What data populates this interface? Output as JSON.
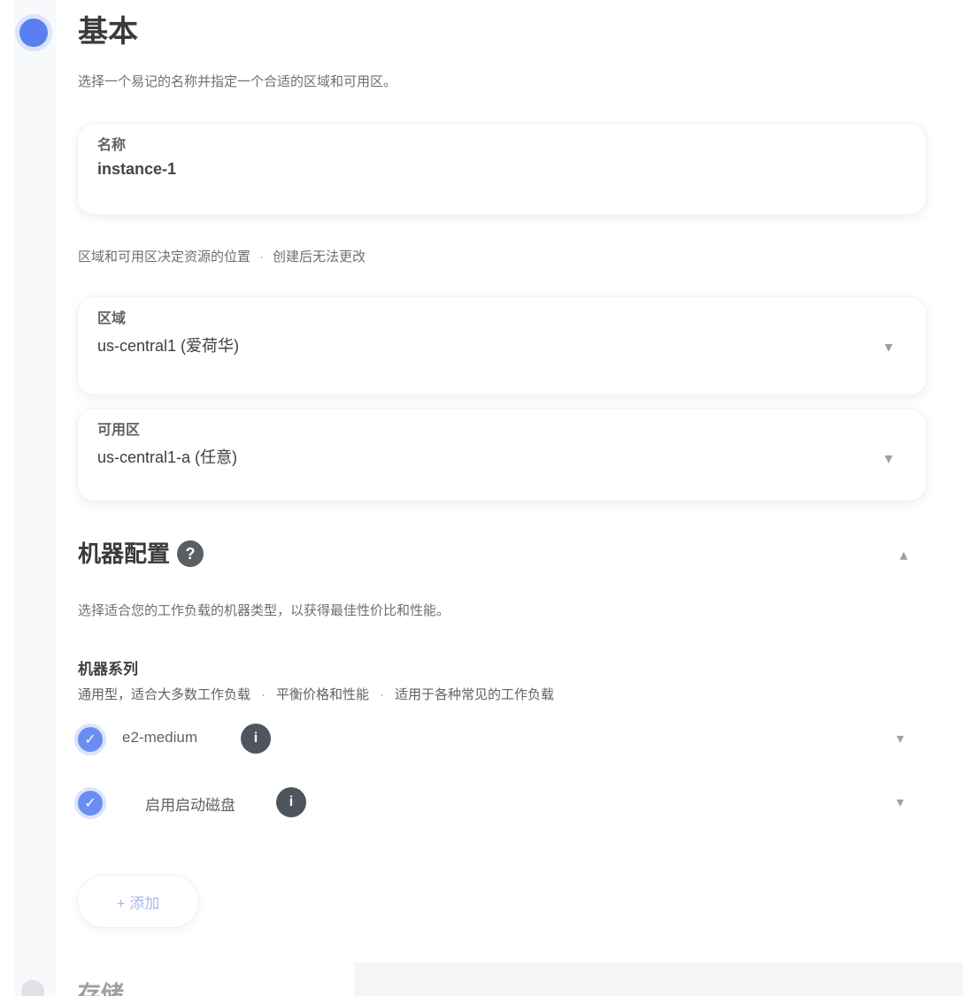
{
  "step": {
    "title": "基本",
    "description": "选择一个易记的名称并指定一个合适的区域和可用区。"
  },
  "name_field": {
    "label": "名称",
    "value": "instance-1"
  },
  "hint": {
    "part1": "区域和可用区决定资源的位置",
    "part2": "创建后无法更改"
  },
  "region_field": {
    "label": "区域",
    "value": "us-central1 (爱荷华)"
  },
  "zone_field": {
    "label": "可用区",
    "value": "us-central1-a (任意)"
  },
  "section": {
    "title": "机器配置",
    "description": "选择适合您的工作负载的机器类型，以获得最佳性价比和性能。",
    "sub_title": "机器系列",
    "sub_desc_1": "通用型，适合大多数工作负载",
    "sub_desc_2": "平衡价格和性能",
    "sub_desc_3": "适用于各种常见的工作负载"
  },
  "options": [
    {
      "label": "e2-medium",
      "checked": true
    },
    {
      "label": "启用启动磁盘",
      "checked": true
    }
  ],
  "add_button": {
    "label": "+ 添加"
  },
  "next_step": {
    "title": "存储"
  },
  "colors": {
    "accent": "#5b7ff0",
    "accent_ring": "#dbe4fd"
  }
}
